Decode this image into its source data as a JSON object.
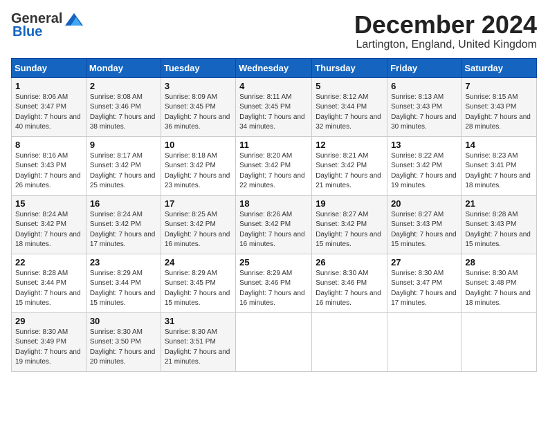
{
  "header": {
    "logo_general": "General",
    "logo_blue": "Blue",
    "month_title": "December 2024",
    "location": "Lartington, England, United Kingdom"
  },
  "weekdays": [
    "Sunday",
    "Monday",
    "Tuesday",
    "Wednesday",
    "Thursday",
    "Friday",
    "Saturday"
  ],
  "weeks": [
    [
      {
        "day": "1",
        "sunrise": "Sunrise: 8:06 AM",
        "sunset": "Sunset: 3:47 PM",
        "daylight": "Daylight: 7 hours and 40 minutes."
      },
      {
        "day": "2",
        "sunrise": "Sunrise: 8:08 AM",
        "sunset": "Sunset: 3:46 PM",
        "daylight": "Daylight: 7 hours and 38 minutes."
      },
      {
        "day": "3",
        "sunrise": "Sunrise: 8:09 AM",
        "sunset": "Sunset: 3:45 PM",
        "daylight": "Daylight: 7 hours and 36 minutes."
      },
      {
        "day": "4",
        "sunrise": "Sunrise: 8:11 AM",
        "sunset": "Sunset: 3:45 PM",
        "daylight": "Daylight: 7 hours and 34 minutes."
      },
      {
        "day": "5",
        "sunrise": "Sunrise: 8:12 AM",
        "sunset": "Sunset: 3:44 PM",
        "daylight": "Daylight: 7 hours and 32 minutes."
      },
      {
        "day": "6",
        "sunrise": "Sunrise: 8:13 AM",
        "sunset": "Sunset: 3:43 PM",
        "daylight": "Daylight: 7 hours and 30 minutes."
      },
      {
        "day": "7",
        "sunrise": "Sunrise: 8:15 AM",
        "sunset": "Sunset: 3:43 PM",
        "daylight": "Daylight: 7 hours and 28 minutes."
      }
    ],
    [
      {
        "day": "8",
        "sunrise": "Sunrise: 8:16 AM",
        "sunset": "Sunset: 3:43 PM",
        "daylight": "Daylight: 7 hours and 26 minutes."
      },
      {
        "day": "9",
        "sunrise": "Sunrise: 8:17 AM",
        "sunset": "Sunset: 3:42 PM",
        "daylight": "Daylight: 7 hours and 25 minutes."
      },
      {
        "day": "10",
        "sunrise": "Sunrise: 8:18 AM",
        "sunset": "Sunset: 3:42 PM",
        "daylight": "Daylight: 7 hours and 23 minutes."
      },
      {
        "day": "11",
        "sunrise": "Sunrise: 8:20 AM",
        "sunset": "Sunset: 3:42 PM",
        "daylight": "Daylight: 7 hours and 22 minutes."
      },
      {
        "day": "12",
        "sunrise": "Sunrise: 8:21 AM",
        "sunset": "Sunset: 3:42 PM",
        "daylight": "Daylight: 7 hours and 21 minutes."
      },
      {
        "day": "13",
        "sunrise": "Sunrise: 8:22 AM",
        "sunset": "Sunset: 3:42 PM",
        "daylight": "Daylight: 7 hours and 19 minutes."
      },
      {
        "day": "14",
        "sunrise": "Sunrise: 8:23 AM",
        "sunset": "Sunset: 3:41 PM",
        "daylight": "Daylight: 7 hours and 18 minutes."
      }
    ],
    [
      {
        "day": "15",
        "sunrise": "Sunrise: 8:24 AM",
        "sunset": "Sunset: 3:42 PM",
        "daylight": "Daylight: 7 hours and 18 minutes."
      },
      {
        "day": "16",
        "sunrise": "Sunrise: 8:24 AM",
        "sunset": "Sunset: 3:42 PM",
        "daylight": "Daylight: 7 hours and 17 minutes."
      },
      {
        "day": "17",
        "sunrise": "Sunrise: 8:25 AM",
        "sunset": "Sunset: 3:42 PM",
        "daylight": "Daylight: 7 hours and 16 minutes."
      },
      {
        "day": "18",
        "sunrise": "Sunrise: 8:26 AM",
        "sunset": "Sunset: 3:42 PM",
        "daylight": "Daylight: 7 hours and 16 minutes."
      },
      {
        "day": "19",
        "sunrise": "Sunrise: 8:27 AM",
        "sunset": "Sunset: 3:42 PM",
        "daylight": "Daylight: 7 hours and 15 minutes."
      },
      {
        "day": "20",
        "sunrise": "Sunrise: 8:27 AM",
        "sunset": "Sunset: 3:43 PM",
        "daylight": "Daylight: 7 hours and 15 minutes."
      },
      {
        "day": "21",
        "sunrise": "Sunrise: 8:28 AM",
        "sunset": "Sunset: 3:43 PM",
        "daylight": "Daylight: 7 hours and 15 minutes."
      }
    ],
    [
      {
        "day": "22",
        "sunrise": "Sunrise: 8:28 AM",
        "sunset": "Sunset: 3:44 PM",
        "daylight": "Daylight: 7 hours and 15 minutes."
      },
      {
        "day": "23",
        "sunrise": "Sunrise: 8:29 AM",
        "sunset": "Sunset: 3:44 PM",
        "daylight": "Daylight: 7 hours and 15 minutes."
      },
      {
        "day": "24",
        "sunrise": "Sunrise: 8:29 AM",
        "sunset": "Sunset: 3:45 PM",
        "daylight": "Daylight: 7 hours and 15 minutes."
      },
      {
        "day": "25",
        "sunrise": "Sunrise: 8:29 AM",
        "sunset": "Sunset: 3:46 PM",
        "daylight": "Daylight: 7 hours and 16 minutes."
      },
      {
        "day": "26",
        "sunrise": "Sunrise: 8:30 AM",
        "sunset": "Sunset: 3:46 PM",
        "daylight": "Daylight: 7 hours and 16 minutes."
      },
      {
        "day": "27",
        "sunrise": "Sunrise: 8:30 AM",
        "sunset": "Sunset: 3:47 PM",
        "daylight": "Daylight: 7 hours and 17 minutes."
      },
      {
        "day": "28",
        "sunrise": "Sunrise: 8:30 AM",
        "sunset": "Sunset: 3:48 PM",
        "daylight": "Daylight: 7 hours and 18 minutes."
      }
    ],
    [
      {
        "day": "29",
        "sunrise": "Sunrise: 8:30 AM",
        "sunset": "Sunset: 3:49 PM",
        "daylight": "Daylight: 7 hours and 19 minutes."
      },
      {
        "day": "30",
        "sunrise": "Sunrise: 8:30 AM",
        "sunset": "Sunset: 3:50 PM",
        "daylight": "Daylight: 7 hours and 20 minutes."
      },
      {
        "day": "31",
        "sunrise": "Sunrise: 8:30 AM",
        "sunset": "Sunset: 3:51 PM",
        "daylight": "Daylight: 7 hours and 21 minutes."
      },
      null,
      null,
      null,
      null
    ]
  ]
}
